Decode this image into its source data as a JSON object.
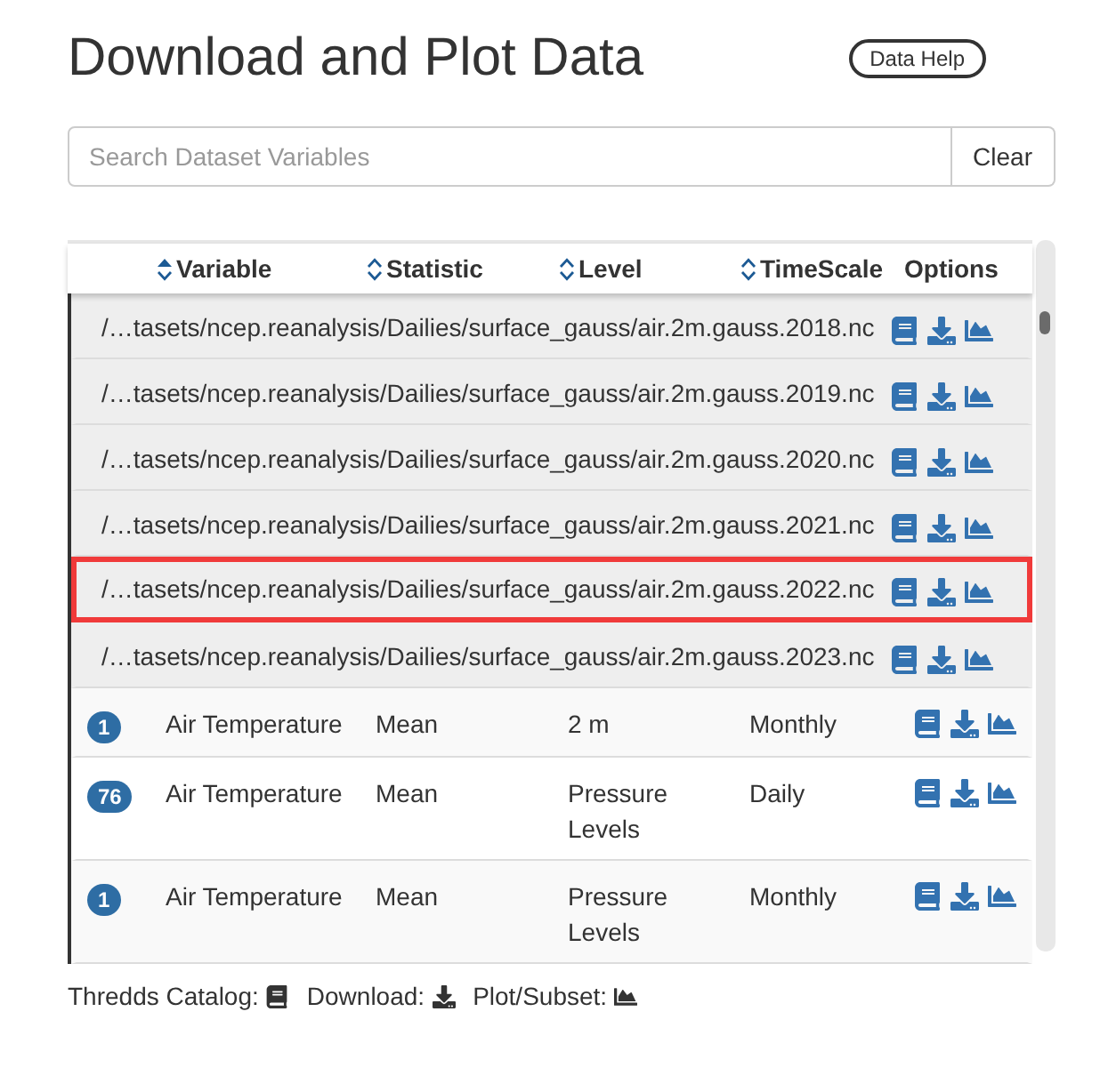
{
  "title": "Download and Plot Data",
  "help_button": "Data Help",
  "search": {
    "placeholder": "Search Dataset Variables",
    "clear": "Clear"
  },
  "table": {
    "columns": [
      {
        "label": "Variable",
        "sorted": true
      },
      {
        "label": "Statistic",
        "sorted": false
      },
      {
        "label": "Level",
        "sorted": false
      },
      {
        "label": "TimeScale",
        "sorted": false
      },
      {
        "label": "Options"
      }
    ],
    "rows": [
      {
        "kind": "file",
        "path": "/…tasets/ncep.reanalysis/Dailies/surface_gauss/air.2m.gauss.2018.nc",
        "highlighted": false
      },
      {
        "kind": "file",
        "path": "/…tasets/ncep.reanalysis/Dailies/surface_gauss/air.2m.gauss.2019.nc",
        "highlighted": false
      },
      {
        "kind": "file",
        "path": "/…tasets/ncep.reanalysis/Dailies/surface_gauss/air.2m.gauss.2020.nc",
        "highlighted": false
      },
      {
        "kind": "file",
        "path": "/…tasets/ncep.reanalysis/Dailies/surface_gauss/air.2m.gauss.2021.nc",
        "highlighted": false
      },
      {
        "kind": "file",
        "path": "/…tasets/ncep.reanalysis/Dailies/surface_gauss/air.2m.gauss.2022.nc",
        "highlighted": true
      },
      {
        "kind": "file",
        "path": "/…tasets/ncep.reanalysis/Dailies/surface_gauss/air.2m.gauss.2023.nc",
        "highlighted": false
      },
      {
        "kind": "variable",
        "count": "1",
        "variable": "Air Temperature",
        "statistic": "Mean",
        "level": "2 m",
        "timescale": "Monthly",
        "highlighted": false
      },
      {
        "kind": "variable",
        "count": "76",
        "variable": "Air Temperature",
        "statistic": "Mean",
        "level": "Pressure Levels",
        "timescale": "Daily",
        "highlighted": false
      },
      {
        "kind": "variable",
        "count": "1",
        "variable": "Air Temperature",
        "statistic": "Mean",
        "level": "Pressure Levels",
        "timescale": "Monthly",
        "highlighted": false
      }
    ]
  },
  "legend": [
    {
      "kind": "catalog",
      "label": "Thredds Catalog:"
    },
    {
      "kind": "download",
      "label": "Download:"
    },
    {
      "kind": "plot",
      "label": "Plot/Subset:"
    }
  ]
}
